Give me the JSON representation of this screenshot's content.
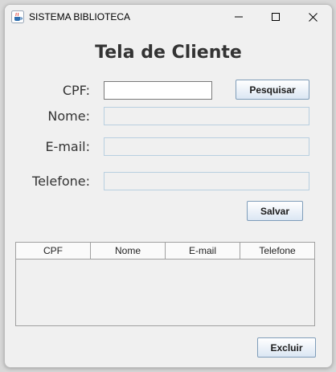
{
  "window": {
    "title": "SISTEMA BIBLIOTECA",
    "app_icon": "java-cup-icon",
    "controls": [
      "minimize-icon",
      "maximize-icon",
      "close-icon"
    ]
  },
  "form": {
    "heading": "Tela de Cliente",
    "cpf_label": "CPF:",
    "cpf_value": "",
    "nome_label": "Nome:",
    "nome_value": "",
    "email_label": "E-mail:",
    "email_value": "",
    "telefone_label": "Telefone:",
    "telefone_value": "",
    "search_button": "Pesquisar",
    "save_button": "Salvar"
  },
  "table": {
    "columns": [
      "CPF",
      "Nome",
      "E-mail",
      "Telefone"
    ],
    "rows": []
  },
  "footer": {
    "delete_button": "Excluir"
  },
  "colors": {
    "window_bg": "#f0f0f0",
    "disabled_field_border": "#b8cfe0",
    "button_border": "#7f9db9"
  }
}
